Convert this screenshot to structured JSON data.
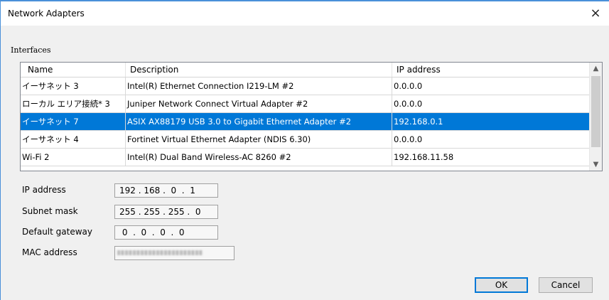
{
  "window": {
    "title": "Network Adapters",
    "close_glyph": "×"
  },
  "interfaces": {
    "group_label": "Interfaces",
    "columns": [
      "Name",
      "Description",
      "IP address"
    ],
    "rows": [
      {
        "name": "イーサネット 3",
        "description": "Intel(R) Ethernet Connection I219-LM #2",
        "ip": "0.0.0.0",
        "selected": false
      },
      {
        "name": "ローカル エリア接続* 3",
        "description": "Juniper Network Connect Virtual Adapter #2",
        "ip": "0.0.0.0",
        "selected": false
      },
      {
        "name": "イーサネット 7",
        "description": "ASIX AX88179 USB 3.0 to Gigabit Ethernet Adapter #2",
        "ip": "192.168.0.1",
        "selected": true
      },
      {
        "name": "イーサネット 4",
        "description": "Fortinet Virtual Ethernet Adapter (NDIS 6.30)",
        "ip": "0.0.0.0",
        "selected": false
      },
      {
        "name": "Wi-Fi 2",
        "description": "Intel(R) Dual Band Wireless-AC 8260 #2",
        "ip": "192.168.11.58",
        "selected": false
      }
    ],
    "scroll_up_glyph": "▲",
    "scroll_down_glyph": "▼"
  },
  "details": {
    "ip_label": "IP address",
    "ip_value": "192 . 168 .  0  .  1",
    "subnet_label": "Subnet mask",
    "subnet_value": "255 . 255 . 255 .  0",
    "gateway_label": "Default gateway",
    "gateway_value": " 0  .  0  .  0  .  0",
    "mac_label": "MAC address"
  },
  "buttons": {
    "ok": "OK",
    "cancel": "Cancel"
  },
  "colors": {
    "selection": "#0078d7",
    "window_border": "#4a90d9"
  }
}
